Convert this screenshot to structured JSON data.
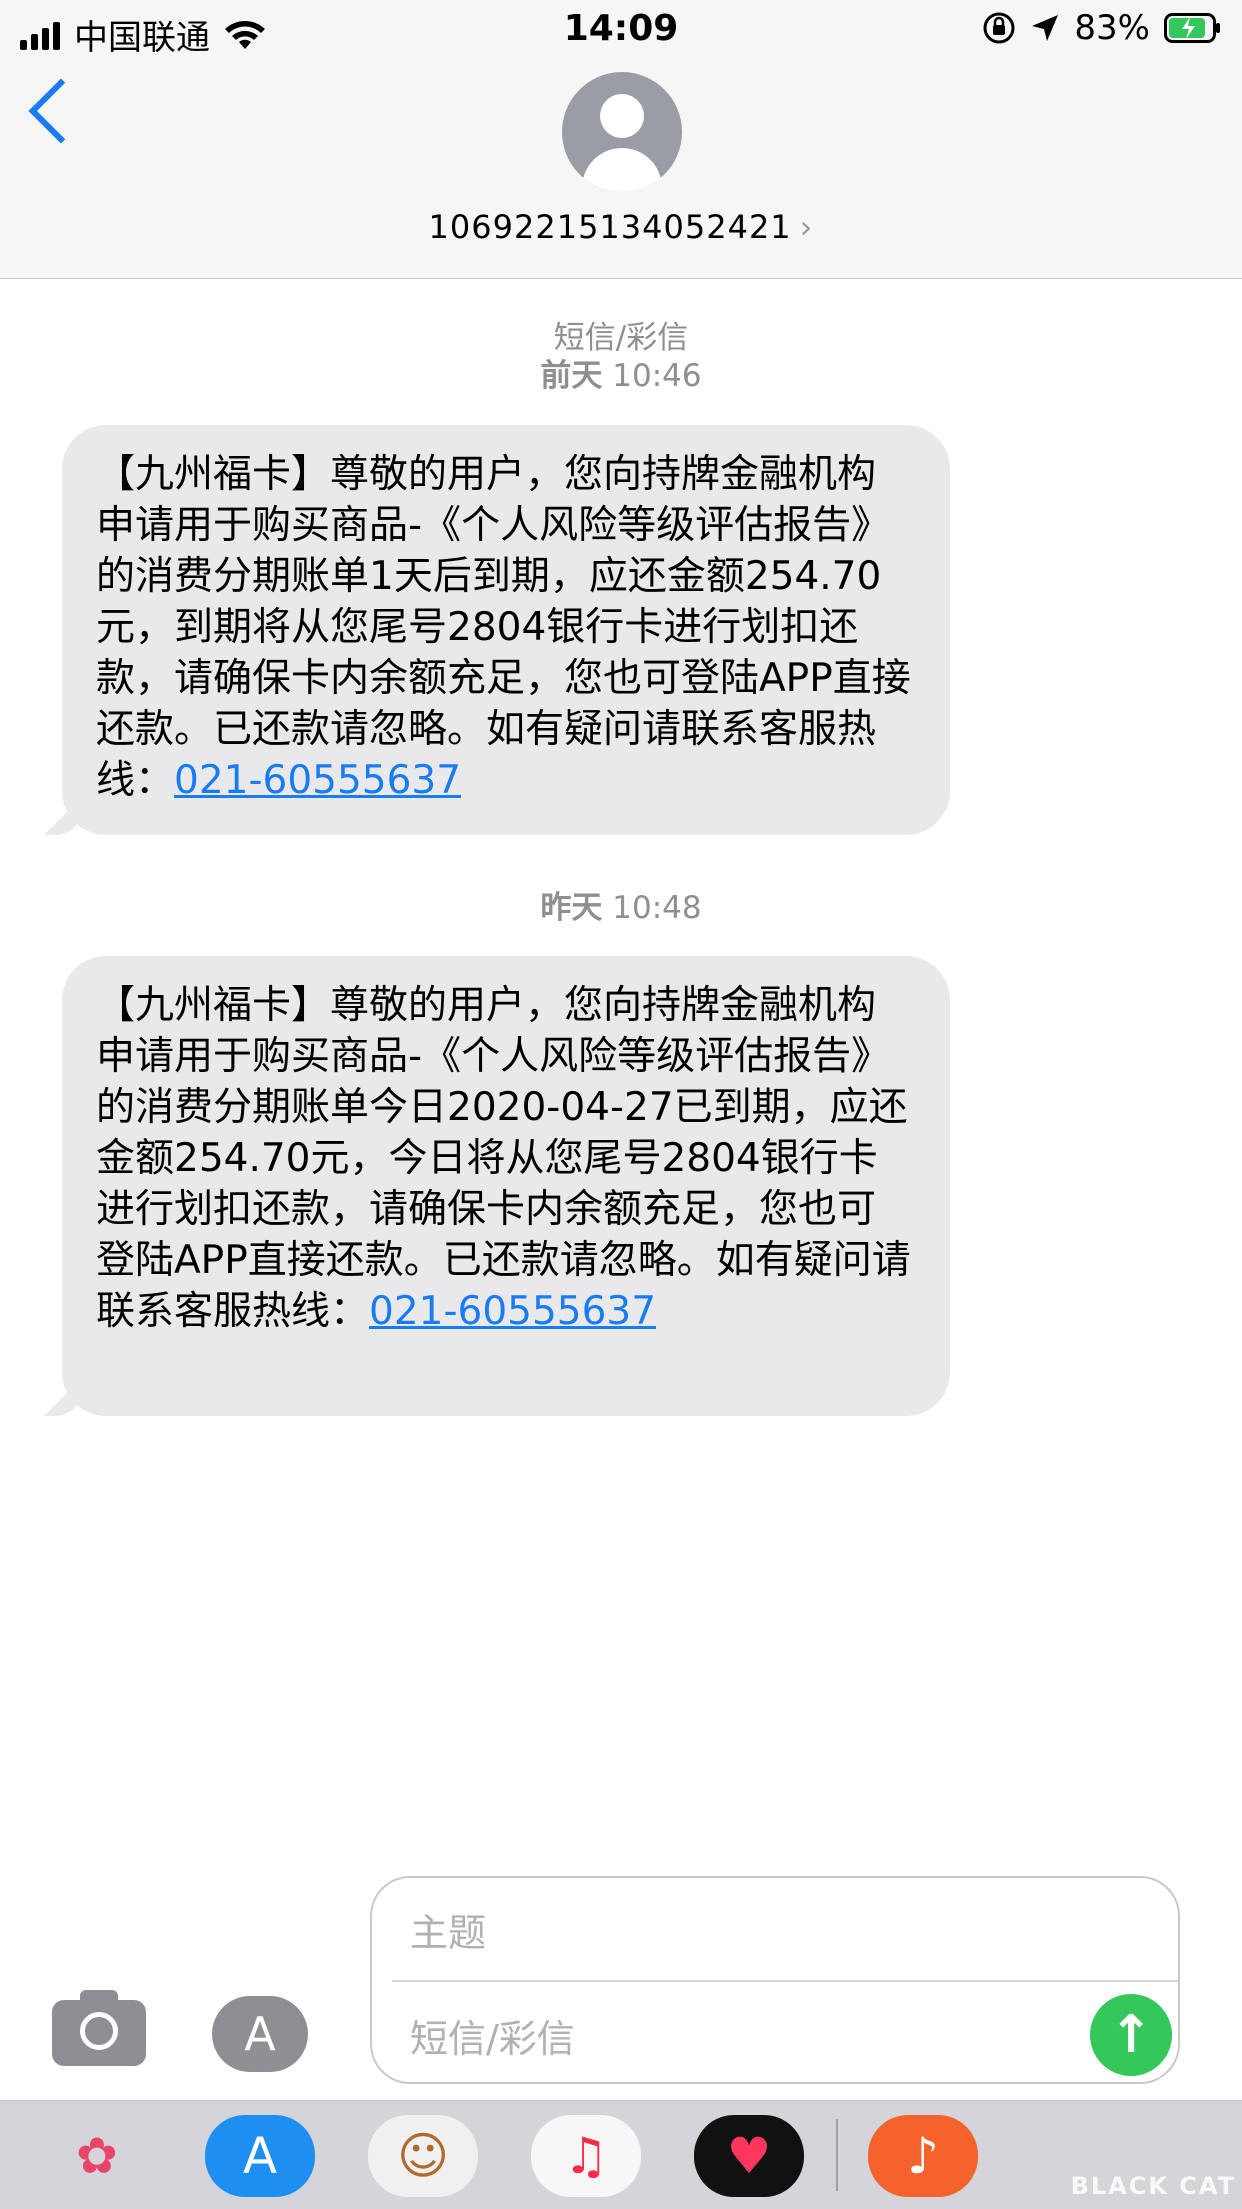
{
  "status_bar": {
    "carrier": "中国联通",
    "time": "14:09",
    "battery_percent": "83%"
  },
  "header": {
    "contact_number": "10692215134052421",
    "chevron": "›"
  },
  "messages": [
    {
      "service_label": "短信/彩信",
      "timestamp_day": "前天",
      "timestamp_time": "10:46",
      "text": "【九州福卡】尊敬的用户，您向持牌金融机构申请用于购买商品-《个人风险等级评估报告》的消费分期账单1天后到期，应还金额254.70元，到期将从您尾号2804银行卡进行划扣还款，请确保卡内余额充足，您也可登陆APP直接还款。已还款请忽略。如有疑问请联系客服热线：",
      "phone_link": "021-60555637"
    },
    {
      "timestamp_day": "昨天",
      "timestamp_time": "10:48",
      "text": "【九州福卡】尊敬的用户，您向持牌金融机构申请用于购买商品-《个人风险等级评估报告》的消费分期账单今日2020-04-27已到期，应还金额254.70元，今日将从您尾号2804银行卡进行划扣还款，请确保卡内余额充足，您也可登陆APP直接还款。已还款请忽略。如有疑问请联系客服热线：",
      "phone_link": "021-60555637"
    }
  ],
  "composer": {
    "subject_placeholder": "主题",
    "message_placeholder": "短信/彩信",
    "send_glyph": "↑",
    "apps_glyph": "A"
  },
  "dock": {
    "apps": [
      {
        "name": "photos-app-icon",
        "glyph": "✿",
        "color": "#f7f7f7"
      },
      {
        "name": "app-store-app-icon",
        "glyph": "A",
        "color": "#1e8ff0"
      },
      {
        "name": "memoji-app-icon",
        "glyph": "☺",
        "color": "#f0f0f0"
      },
      {
        "name": "music-app-icon",
        "glyph": "♫",
        "color": "#f7f7f7"
      },
      {
        "name": "fitness-app-icon",
        "glyph": "♥",
        "color": "#111111"
      },
      {
        "name": "garageband-app-icon",
        "glyph": "♪",
        "color": "#f5632c"
      }
    ]
  },
  "watermark": "BLACK CAT",
  "colors": {
    "accent": "#1a7cf2",
    "bubble": "#e9e9eb",
    "send": "#34c759"
  }
}
